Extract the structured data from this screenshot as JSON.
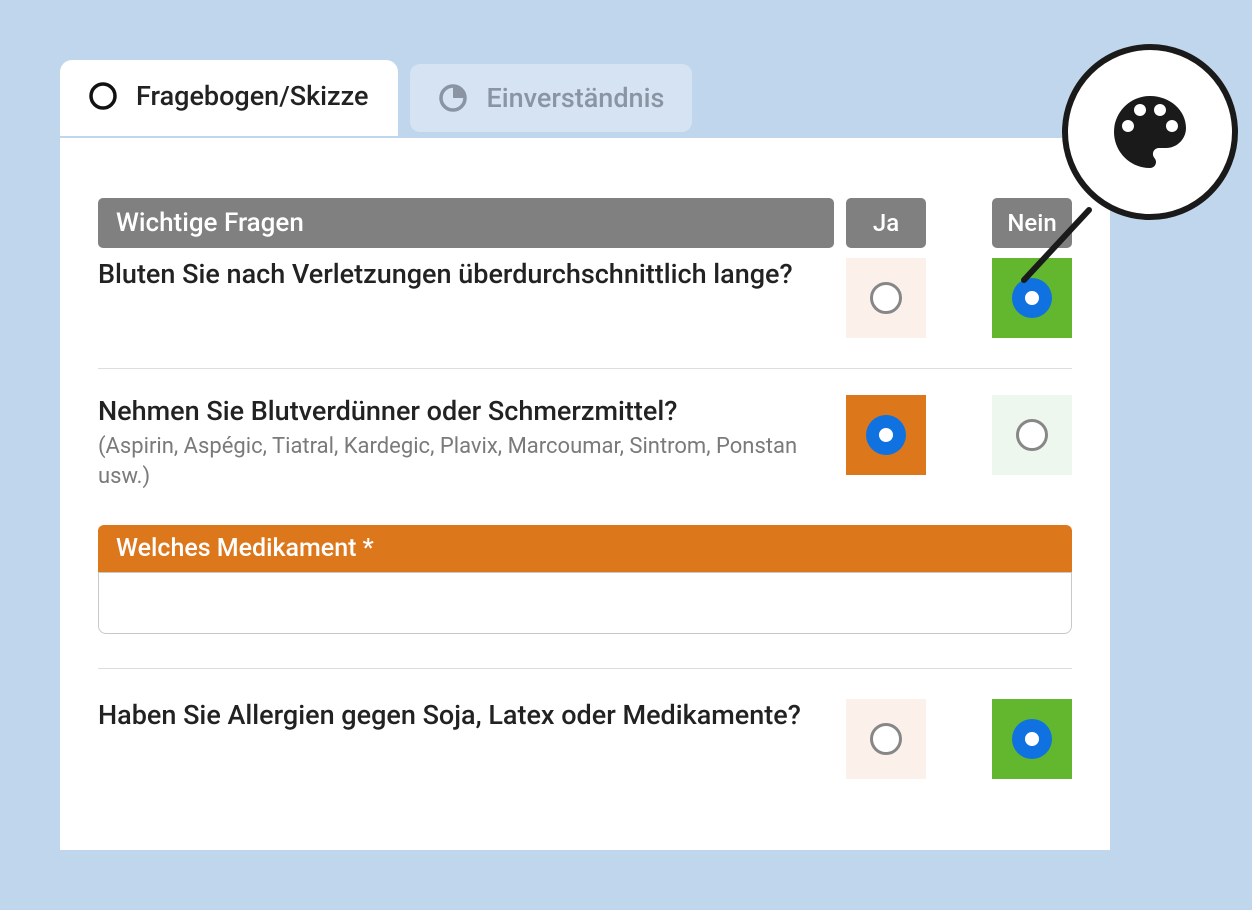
{
  "tabs": {
    "active": "Fragebogen/Skizze",
    "inactive": "Einverständnis"
  },
  "section_title": "Wichtige Fragen",
  "col_yes": "Ja",
  "col_no": "Nein",
  "questions": [
    {
      "text": "Bluten Sie nach Verletzungen überdurchschnittlich lange?",
      "hint": "",
      "answer": "no"
    },
    {
      "text": "Nehmen Sie Blutverdünner oder Schmerzmittel?",
      "hint": "(Aspirin, Aspégic, Tiatral, Kardegic, Plavix, Marcoumar, Sintrom, Ponstan usw.)",
      "answer": "yes"
    },
    {
      "text": "Haben Sie Allergien gegen Soja, Latex oder Medikamente?",
      "hint": "",
      "answer": "no"
    }
  ],
  "followup": {
    "label": "Welches Medikament *",
    "value": ""
  },
  "colors": {
    "accent_blue": "#0f72e0",
    "yes_selected_bg": "#dd771c",
    "no_selected_bg": "#62b72f",
    "header_grey": "#808080"
  }
}
